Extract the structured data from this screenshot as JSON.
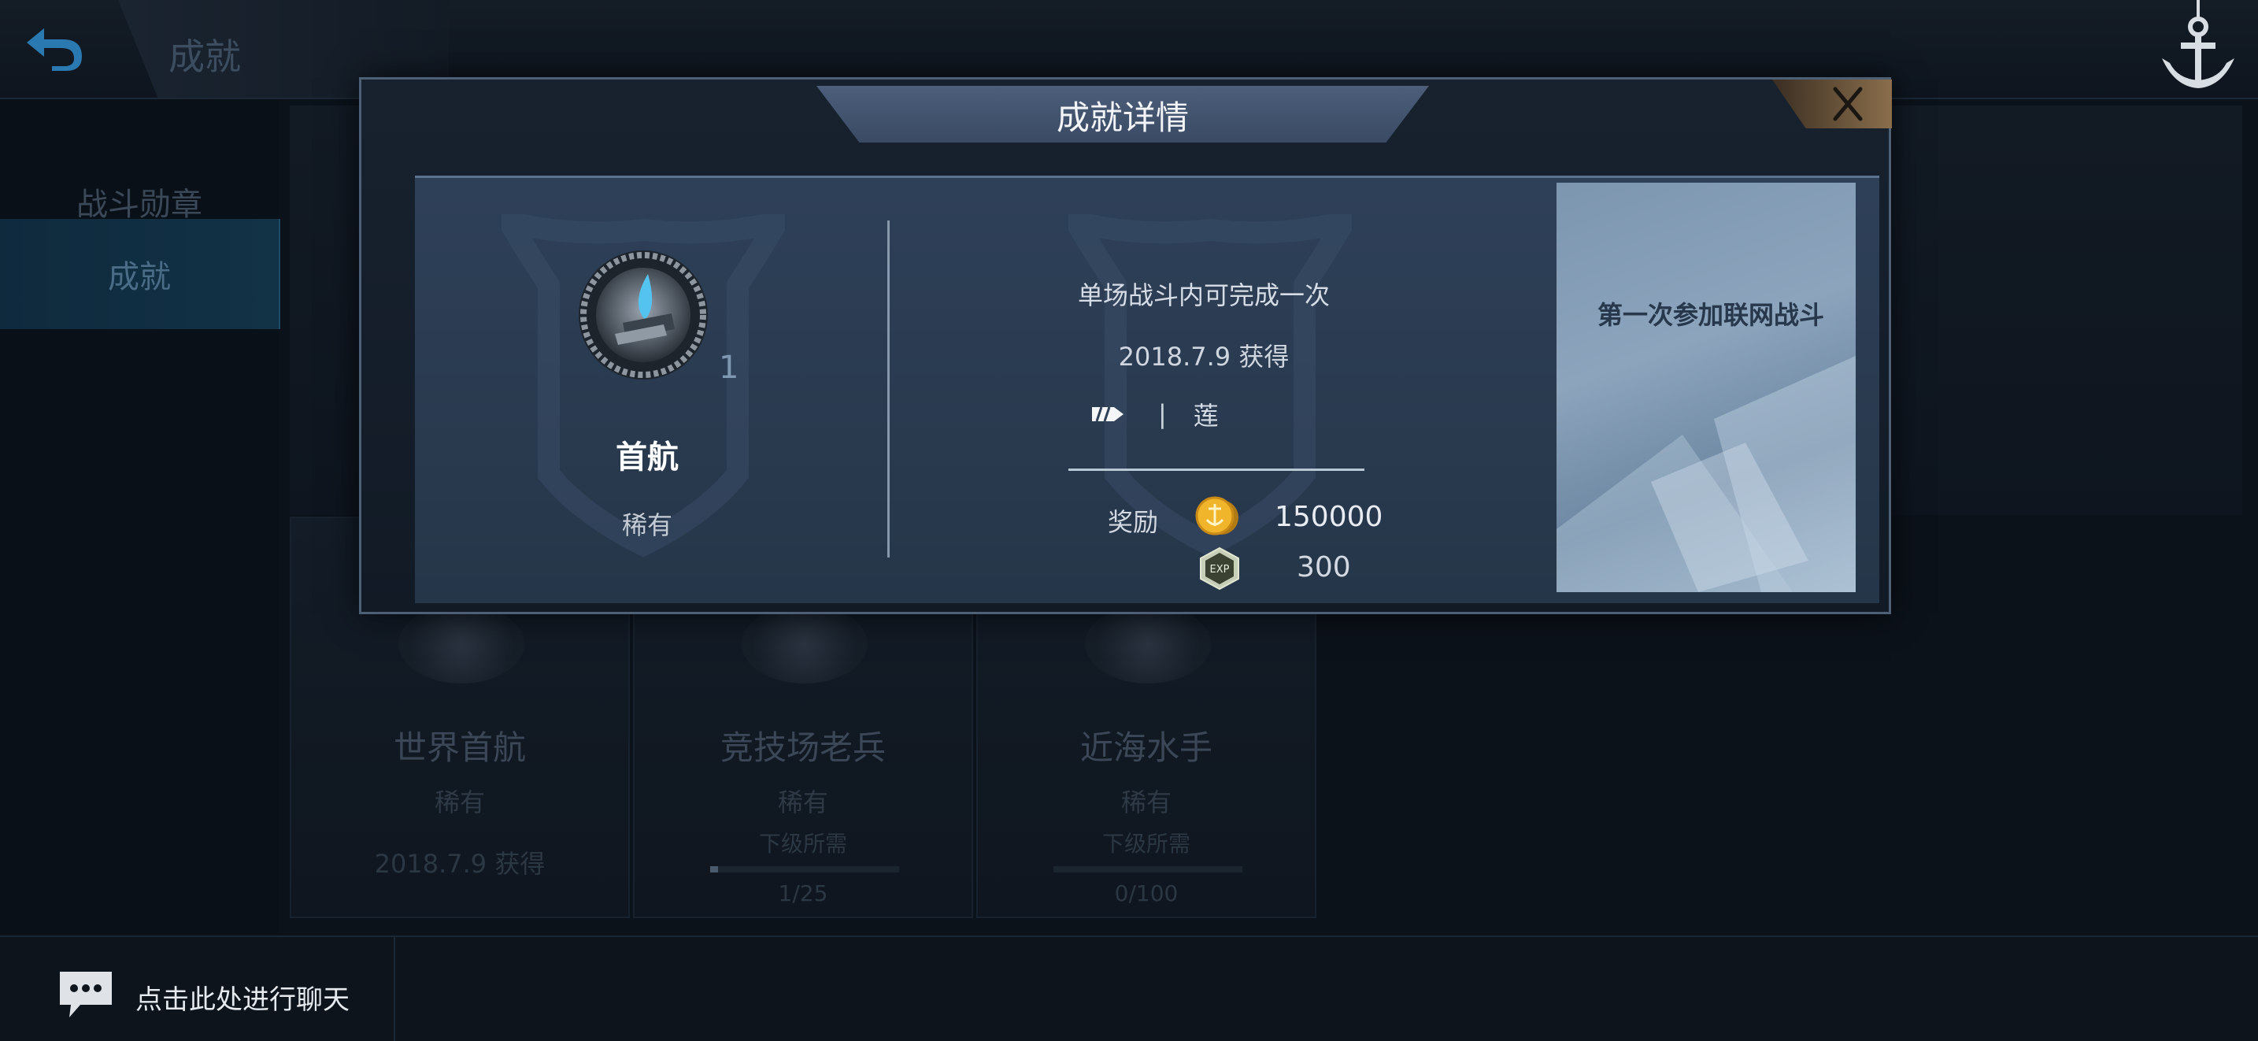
{
  "header": {
    "page_title": "成就",
    "back_icon": "back-arrow-icon",
    "anchor_icon": "anchor-icon"
  },
  "nav": {
    "items": [
      {
        "label": "战斗勋章",
        "active": false
      },
      {
        "label": "成就",
        "active": true
      }
    ]
  },
  "background_cards": [
    {
      "name": "世界首航",
      "rarity": "稀有",
      "date": "2018.7.9  获得"
    },
    {
      "name": "竞技场老兵",
      "rarity": "稀有",
      "need_label": "下级所需",
      "progress_text": "1/25",
      "progress": 0.04
    },
    {
      "name": "近海水手",
      "rarity": "稀有",
      "need_label": "下级所需",
      "progress_text": "0/100",
      "progress": 0.0
    }
  ],
  "chat": {
    "label": "点击此处进行聊天",
    "icon": "chat-bubble-icon"
  },
  "modal": {
    "title": "成就详情",
    "close_icon": "close-icon",
    "medal": {
      "icon": "medal-icon",
      "count": "1",
      "name": "首航",
      "rarity": "稀有"
    },
    "condition": "单场战斗内可完成一次",
    "obtained_date": "2018.7.9  获得",
    "ship": {
      "icon": "ship-class-icon",
      "separator": "|",
      "name": "莲"
    },
    "reward": {
      "label": "奖励",
      "gold_icon": "gold-coin-icon",
      "gold_amount": "150000",
      "exp_icon": "exp-icon",
      "exp_amount": "300"
    },
    "description": "第一次参加联网战斗"
  }
}
